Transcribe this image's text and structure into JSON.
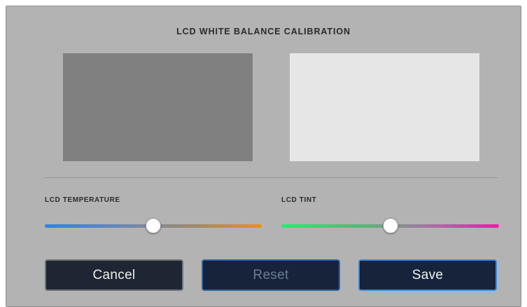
{
  "dialog": {
    "title": "LCD WHITE BALANCE CALIBRATION"
  },
  "swatches": {
    "gray_color": "#808080",
    "white_color": "#e6e6e6"
  },
  "sliders": {
    "temperature": {
      "label": "LCD TEMPERATURE",
      "value_fraction": 0.5,
      "gradient_start": "#2f7ff0",
      "gradient_end": "#e8921e"
    },
    "tint": {
      "label": "LCD TINT",
      "value_fraction": 0.5,
      "gradient_start": "#1ff06a",
      "gradient_end": "#f01aa8"
    }
  },
  "buttons": {
    "cancel_label": "Cancel",
    "reset_label": "Reset",
    "save_label": "Save"
  },
  "colors": {
    "panel_background": "#b3b3b3",
    "button_background": "#16233a",
    "accent_border": "#3e87d8",
    "disabled_text": "#6e7d92"
  }
}
